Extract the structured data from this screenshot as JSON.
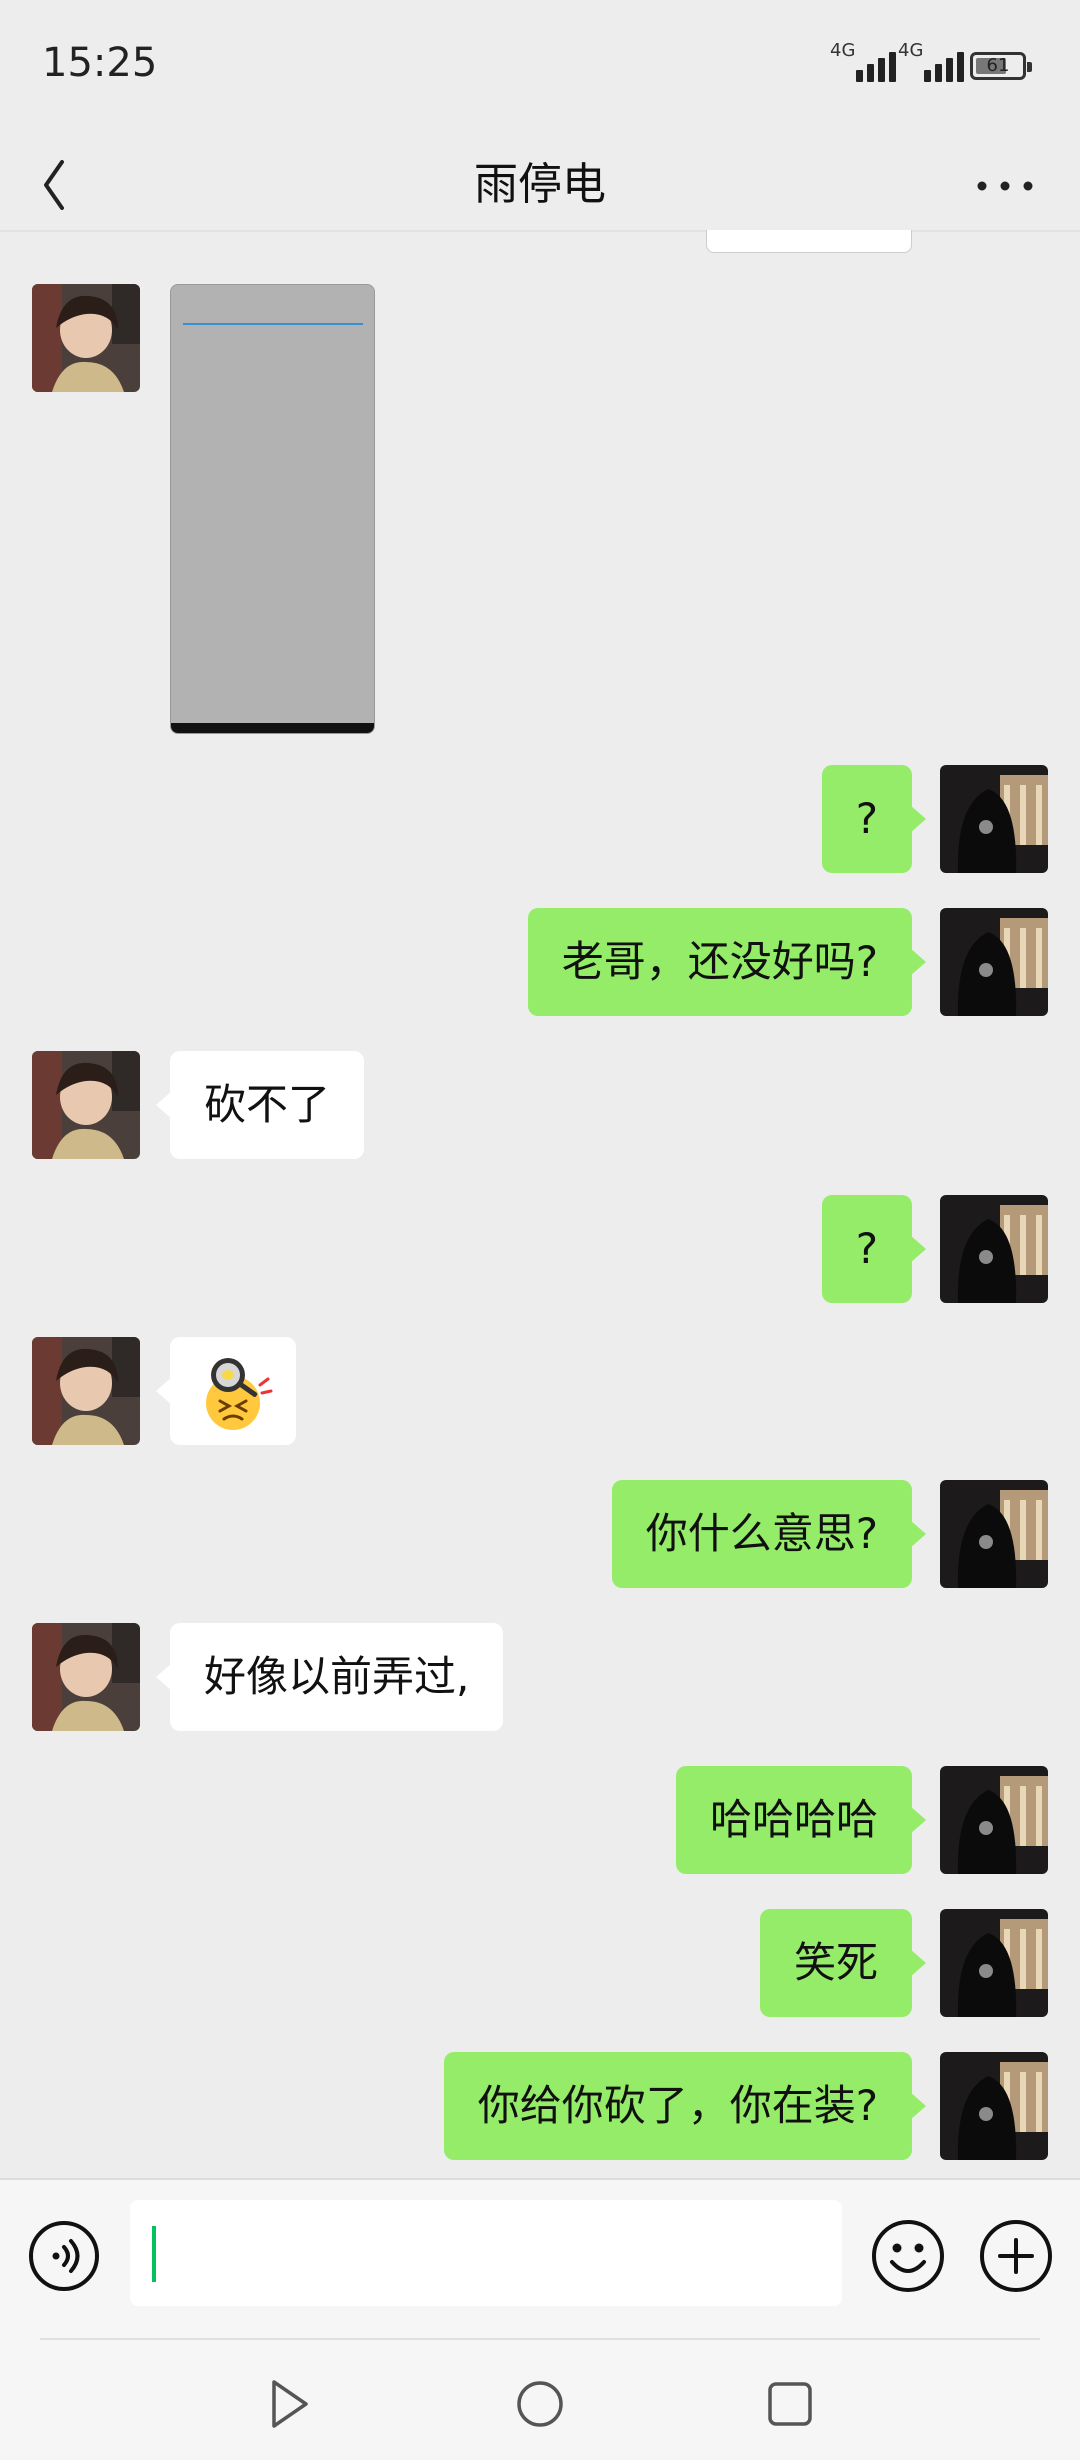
{
  "status_bar": {
    "time": "15:25",
    "signal_1": "4G",
    "signal_2": "4G",
    "battery": "61"
  },
  "header": {
    "title": "雨停电"
  },
  "messages": [
    {
      "from": "them",
      "type": "image"
    },
    {
      "from": "me",
      "text": "?"
    },
    {
      "from": "me",
      "text": "老哥，还没好吗?"
    },
    {
      "from": "them",
      "text": "砍不了"
    },
    {
      "from": "me",
      "text": "?"
    },
    {
      "from": "them",
      "type": "sticker",
      "icon": "frying-pan-angry-face"
    },
    {
      "from": "me",
      "text": "你什么意思?"
    },
    {
      "from": "them",
      "text": "好像以前弄过,"
    },
    {
      "from": "me",
      "text": "哈哈哈哈"
    },
    {
      "from": "me",
      "text": "笑死"
    },
    {
      "from": "me",
      "text": "你给你砍了，你在装?"
    }
  ],
  "colors": {
    "my_bubble": "#95ec69",
    "their_bubble": "#ffffff",
    "background": "#ededed",
    "caret": "#07c160"
  }
}
